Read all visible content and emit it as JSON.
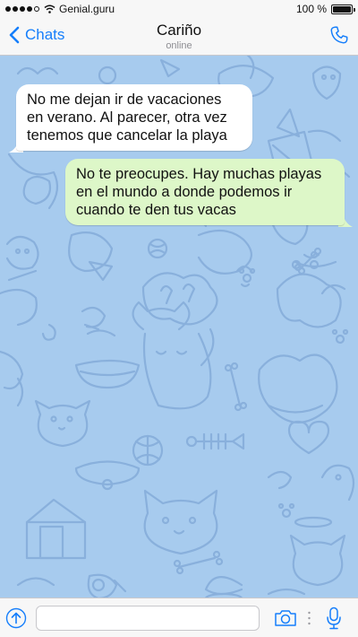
{
  "status_bar": {
    "carrier": "Genial.guru",
    "battery_text": "100 %",
    "battery_level": 1.0,
    "signal_bars_filled": 4,
    "signal_bars_total": 5
  },
  "header": {
    "back_label": "Chats",
    "contact_name": "Cariño",
    "contact_status": "online",
    "back_icon": "chevron-left-icon",
    "call_icon": "phone-icon"
  },
  "messages": [
    {
      "direction": "incoming",
      "text": "No me dejan ir de vacaciones en verano. Al parecer, otra vez tenemos que cancelar la playa"
    },
    {
      "direction": "outgoing",
      "text": "No te preocupes. Hay muchas playas en el mundo a donde podemos ir cuando te den tus vacas"
    }
  ],
  "composer": {
    "placeholder": "",
    "attach_icon": "arrow-up-icon",
    "camera_icon": "camera-icon",
    "mic_icon": "microphone-icon"
  },
  "colors": {
    "accent": "#157efb",
    "chat_background": "#a7cbee",
    "incoming_bubble": "#ffffff",
    "outgoing_bubble": "#ddf7c8"
  }
}
